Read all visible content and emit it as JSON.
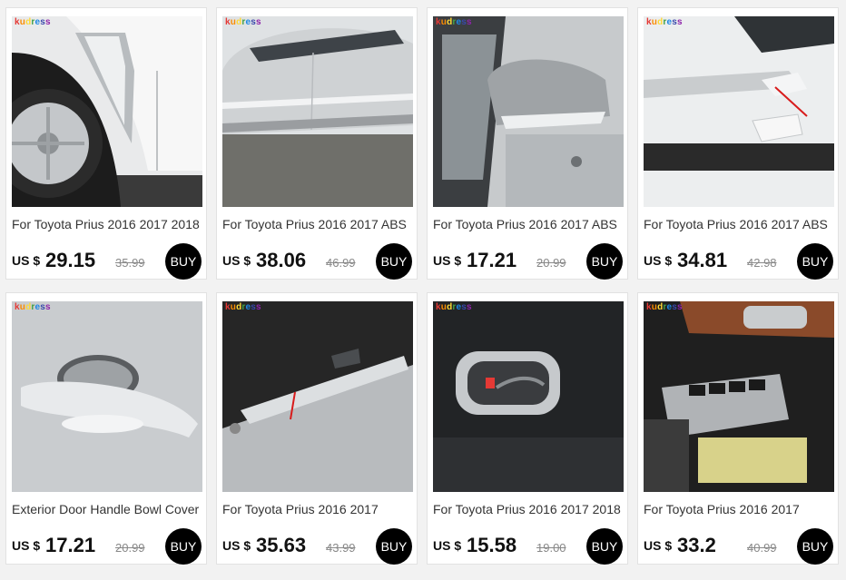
{
  "brand": [
    "k",
    "u",
    "d",
    "r",
    "e",
    "s",
    "s"
  ],
  "brand_colors": [
    "#e53935",
    "#fb8c00",
    "#fdd835",
    "#43a047",
    "#1e88e5",
    "#3949ab",
    "#8e24aa"
  ],
  "currency": "US $",
  "buy_label": "BUY",
  "products": [
    {
      "title": "For Toyota Prius 2016 2017 2018",
      "price": "29.15",
      "old_price": "35.99",
      "image": "front-fender-vent-trim"
    },
    {
      "title": "For Toyota Prius 2016 2017 ABS",
      "price": "38.06",
      "old_price": "46.99",
      "image": "side-door-body-molding"
    },
    {
      "title": "For Toyota Prius 2016 2017 ABS",
      "price": "17.21",
      "old_price": "20.99",
      "image": "side-mirror-trim"
    },
    {
      "title": "For Toyota Prius 2016 2017 ABS",
      "price": "34.81",
      "old_price": "42.98",
      "image": "front-fog-lamp-trim"
    },
    {
      "title": "Exterior Door Handle Bowl Cover",
      "price": "17.21",
      "old_price": "20.99",
      "image": "door-handle-bowl"
    },
    {
      "title": "For Toyota Prius 2016 2017",
      "price": "35.63",
      "old_price": "43.99",
      "image": "rear-bumper-sill-plate"
    },
    {
      "title": "For Toyota Prius 2016 2017 2018",
      "price": "15.58",
      "old_price": "19.00",
      "image": "inner-door-handle-frame"
    },
    {
      "title": "For Toyota Prius 2016 2017",
      "price": "33.2",
      "old_price": "40.99",
      "image": "window-switch-panel"
    }
  ]
}
